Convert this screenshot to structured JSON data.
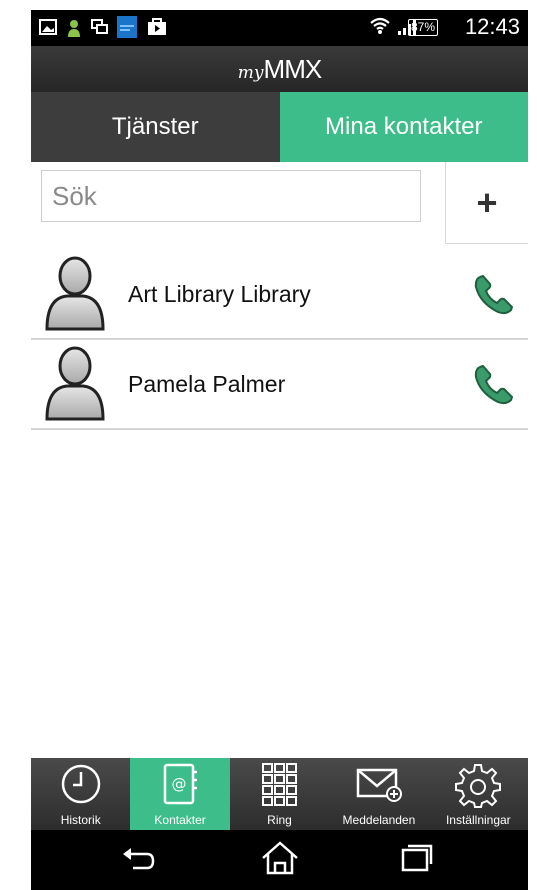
{
  "status_bar": {
    "battery": "87%",
    "time": "12:43"
  },
  "app_bar": {
    "logo_prefix": "my",
    "logo_main": "MMX"
  },
  "tabs": [
    {
      "label": "Tjänster",
      "active": false
    },
    {
      "label": "Mina kontakter",
      "active": true
    }
  ],
  "search": {
    "placeholder": "Sök",
    "value": ""
  },
  "add_button": {
    "label": "+"
  },
  "contacts": [
    {
      "name": "Art Library Library"
    },
    {
      "name": "Pamela Palmer"
    }
  ],
  "bottom_nav": [
    {
      "label": "Historik",
      "icon": "clock-icon",
      "active": false
    },
    {
      "label": "Kontakter",
      "icon": "address-book-icon",
      "active": true
    },
    {
      "label": "Ring",
      "icon": "dialpad-icon",
      "active": false
    },
    {
      "label": "Meddelanden",
      "icon": "envelope-icon",
      "active": false
    },
    {
      "label": "Inställningar",
      "icon": "gear-icon",
      "active": false
    }
  ],
  "colors": {
    "accent": "#3dbd8a",
    "call": "#3a9a6a",
    "dark_bar": "#3d3d3d"
  }
}
